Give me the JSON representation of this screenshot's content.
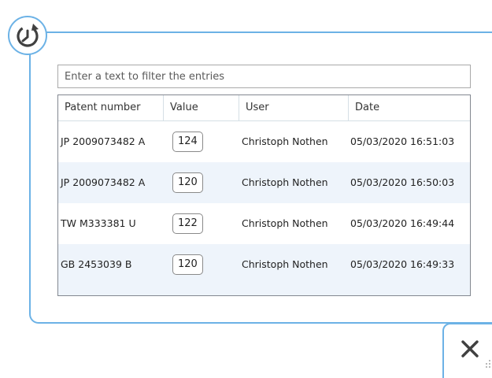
{
  "filter": {
    "placeholder": "Enter a text to filter the entries",
    "value": ""
  },
  "table": {
    "columns": [
      "Patent number",
      "Value",
      "User",
      "Date"
    ],
    "rows": [
      {
        "patent": "JP 2009073482 A",
        "value": "124",
        "user": "Christoph Nothen",
        "date": "05/03/2020 16:51:03"
      },
      {
        "patent": "JP 2009073482 A",
        "value": "120",
        "user": "Christoph Nothen",
        "date": "05/03/2020 16:50:03"
      },
      {
        "patent": "TW M333381 U",
        "value": "122",
        "user": "Christoph Nothen",
        "date": "05/03/2020 16:49:44"
      },
      {
        "patent": "GB 2453039 B",
        "value": "120",
        "user": "Christoph Nothen",
        "date": "05/03/2020 16:49:33"
      }
    ]
  },
  "icons": {
    "history": "history-icon",
    "close": "close-icon",
    "resize": "resize-grip-icon"
  },
  "colors": {
    "accent": "#6cb2e6",
    "row_alt": "#eef4fb",
    "icon": "#404040"
  }
}
